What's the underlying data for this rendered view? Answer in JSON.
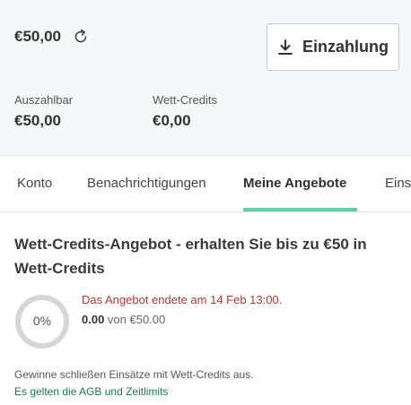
{
  "account": {
    "balance": "€50,00",
    "deposit_label": "Einzahlung",
    "withdrawable_label": "Auszahlbar",
    "withdrawable_value": "€50,00",
    "bet_credits_label": "Wett-Credits",
    "bet_credits_value": "€0,00"
  },
  "tabs": [
    {
      "label": "Konto",
      "active": false
    },
    {
      "label": "Benachrichtigungen",
      "active": false
    },
    {
      "label": "Meine Angebote",
      "active": true
    },
    {
      "label": "Einst",
      "active": false
    }
  ],
  "offer": {
    "title": "Wett-Credits-Angebot - erhalten Sie bis zu €50 in Wett-Credits",
    "progress_label": "0%",
    "progress_fraction": 0,
    "status": "Das Angebot endete am 14 Feb 13:00.",
    "current": "0.00",
    "of_text": " von €50.00",
    "footnote": "Gewinne schließen Einsätze mit Wett-Credits aus.",
    "terms_link": "Es gelten die AGB und Zeitlimits"
  },
  "colors": {
    "accent": "#5ecfa8",
    "expired": "#b03a3a",
    "link": "#1c7a4a",
    "ring": "#d6d6d6"
  }
}
